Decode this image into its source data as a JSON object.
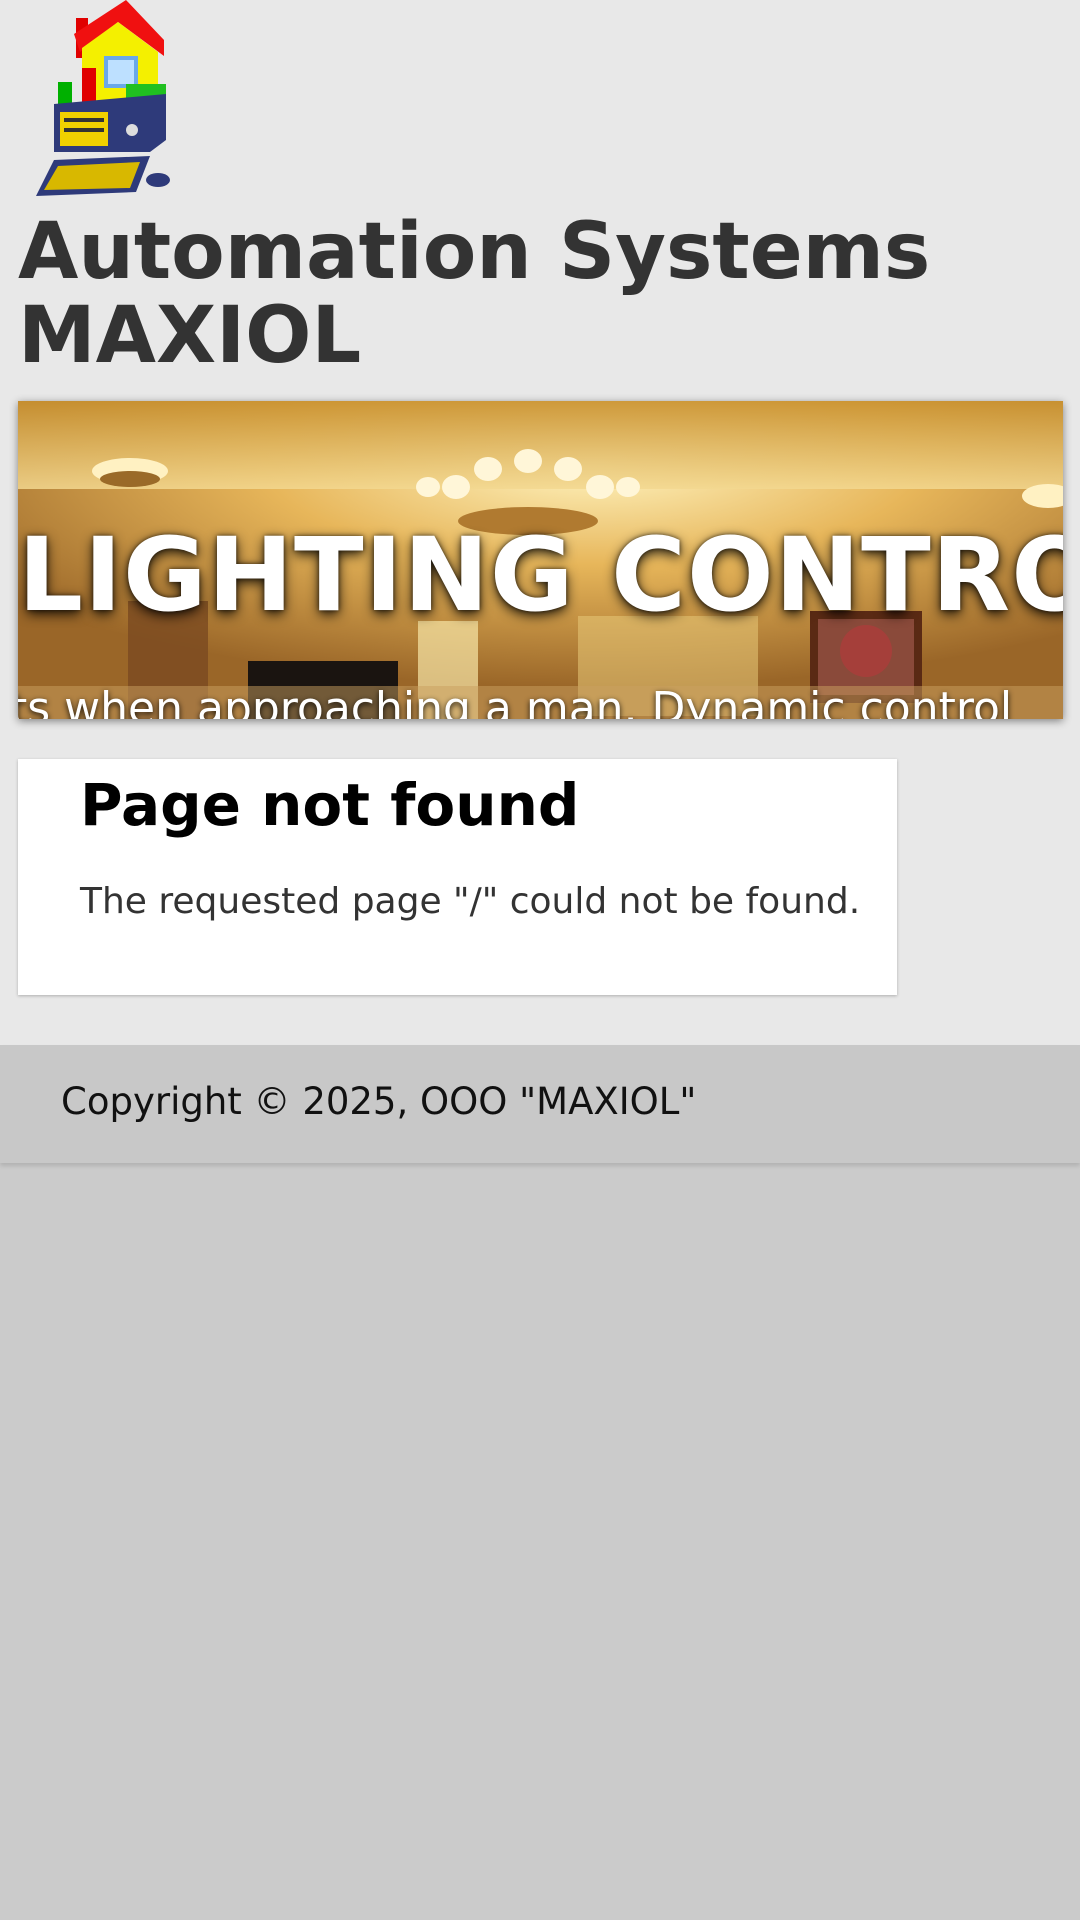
{
  "header": {
    "logo_icon": "house-computer-logo-icon",
    "title_line1": "Automation Systems",
    "title_line2": "MAXIOL"
  },
  "banner": {
    "heading": "LIGHTING CONTROL",
    "scroll_text": "ts when approaching a man. Dynamic control"
  },
  "content": {
    "title": "Page not found",
    "message": "The requested page \"/\" could not be found."
  },
  "footer": {
    "copyright": "Copyright © 2025, OOO \"MAXIOL\""
  },
  "colors": {
    "page_bg": "#e8e8e8",
    "lower_bg": "#cbcbcb",
    "footer_bg": "#c8c8c8",
    "card_bg": "#ffffff",
    "title_text": "#333333"
  }
}
